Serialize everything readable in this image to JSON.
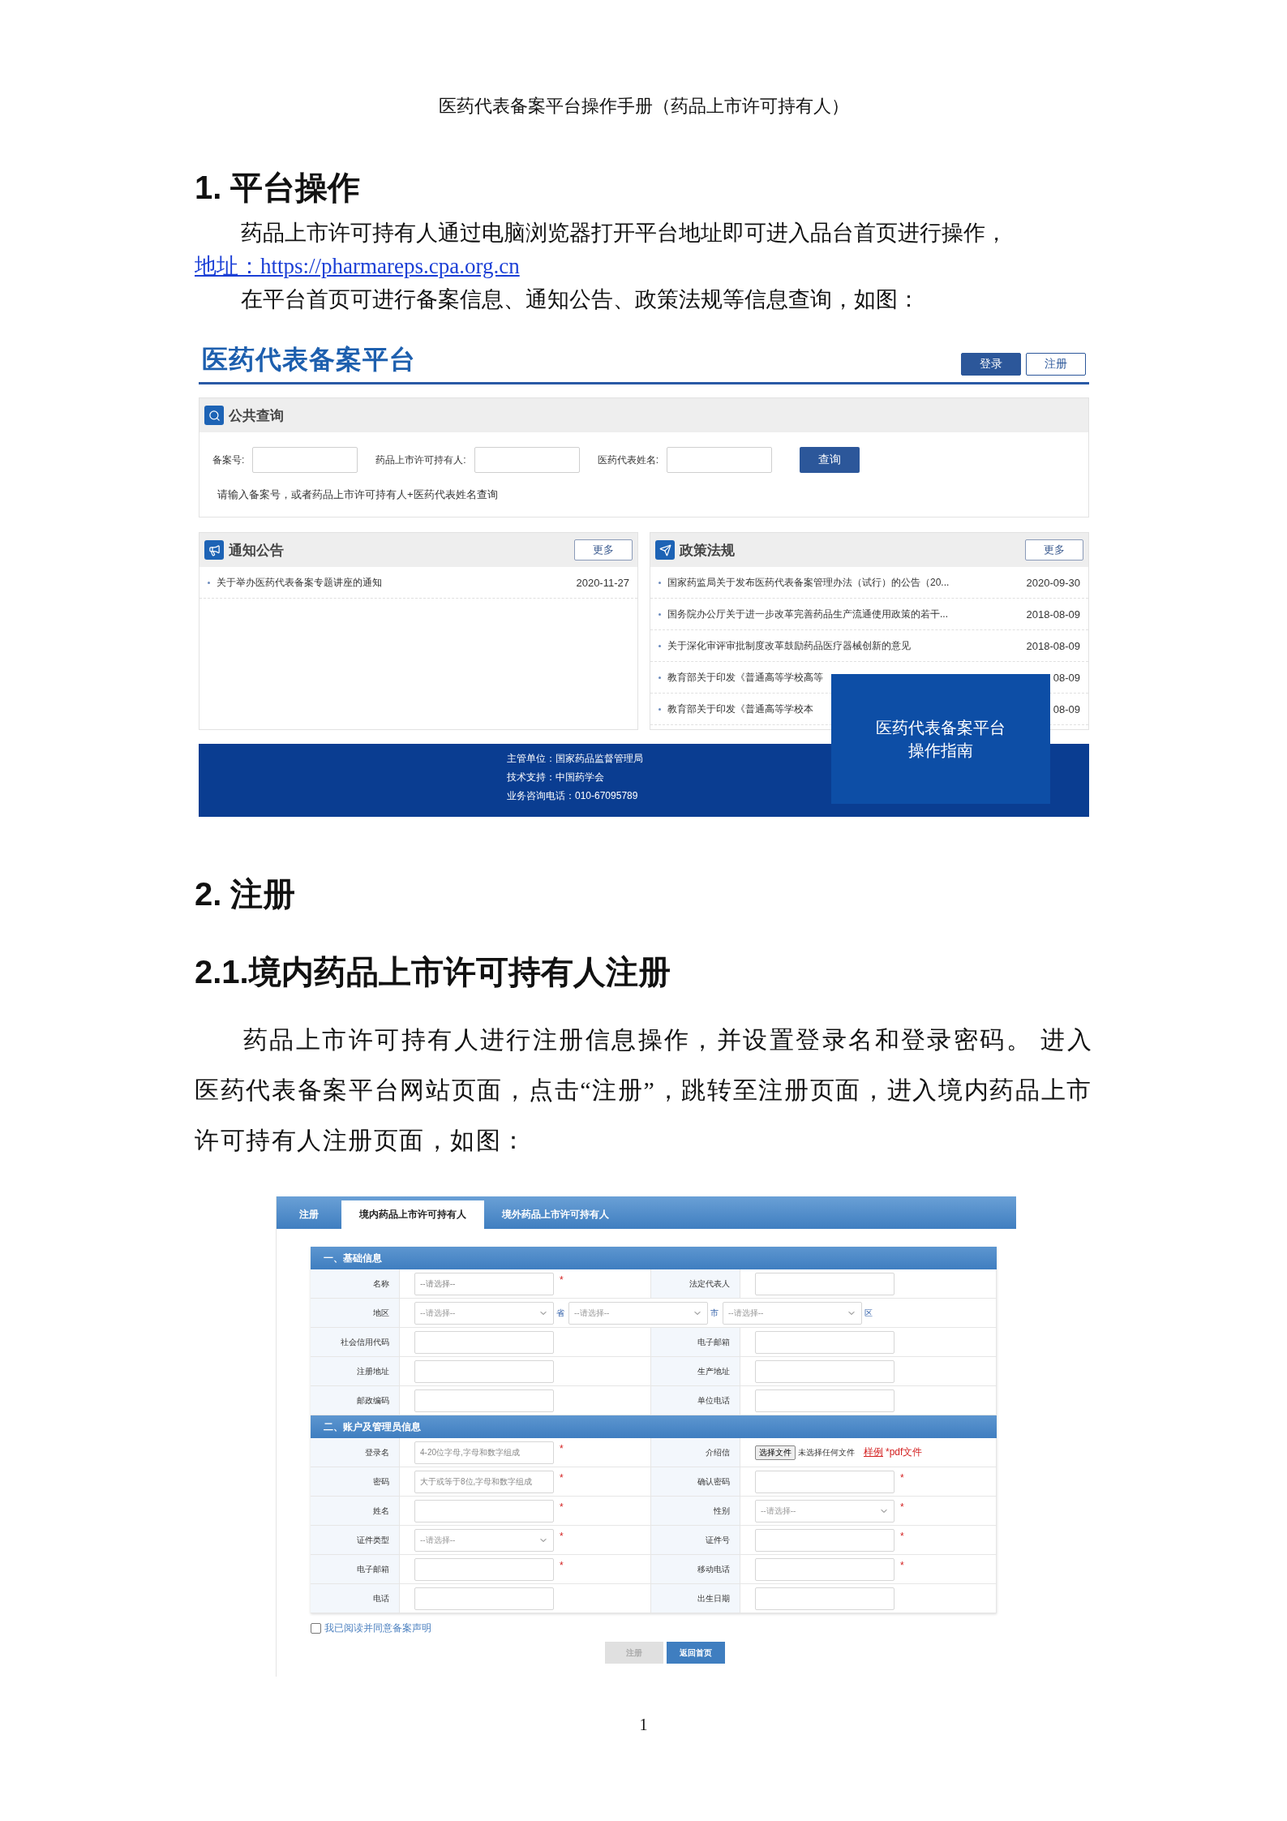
{
  "doc_header": "医药代表备案平台操作手册（药品上市许可持有人）",
  "heading_1": "1. 平台操作",
  "paragraph_1": "药品上市许可持有人通过电脑浏览器打开平台地址即可进入品台首页进行操作，",
  "address_link": "地址：https://pharmareps.cpa.org.cn",
  "paragraph_2": "在平台首页可进行备案信息、通知公告、政策法规等信息查询，如图：",
  "homepage": {
    "logo": "医药代表备案平台",
    "buttons": [
      {
        "label": "登录",
        "kind": "primary"
      },
      {
        "label": "注册",
        "kind": "outline"
      }
    ],
    "public_query": {
      "title": "公共查询",
      "fields": [
        {
          "label": "备案号:"
        },
        {
          "label": "药品上市许可持有人:"
        },
        {
          "label": "医药代表姓名:"
        }
      ],
      "button": "查询",
      "hint": "请输入备案号，或者药品上市许可持有人+医药代表姓名查询"
    },
    "panels": [
      {
        "kind": "announcement",
        "title": "通知公告",
        "more": "更多",
        "items": [
          {
            "title": "关于举办医药代表备案专题讲座的通知",
            "date": "2020-11-27"
          }
        ]
      },
      {
        "kind": "policy",
        "title": "政策法规",
        "more": "更多",
        "items": [
          {
            "title": "国家药监局关于发布医药代表备案管理办法（试行）的公告（20...",
            "date": "2020-09-30"
          },
          {
            "title": "国务院办公厅关于进一步改革完善药品生产流通使用政策的若干...",
            "date": "2018-08-09"
          },
          {
            "title": "关于深化审评审批制度改革鼓励药品医疗器械创新的意见",
            "date": "2018-08-09"
          },
          {
            "title": "教育部关于印发《普通高等学校高等",
            "date": "08-09"
          },
          {
            "title": "教育部关于印发《普通高等学校本",
            "date": "08-09"
          }
        ]
      }
    ],
    "footer": [
      "主管单位：国家药品监督管理局",
      "技术支持：中国药学会",
      "业务咨询电话：010-67095789"
    ],
    "guide_overlay": [
      "医药代表备案平台",
      "操作指南"
    ]
  },
  "heading_2": "2. 注册",
  "heading_2_1": "2.1.境内药品上市许可持有人注册",
  "paragraph_3": "药品上市许可持有人进行注册信息操作，并设置登录名和登录密码。 进入医药代表备案平台网站页面，点击“注册”，跳转至注册页面，进入境内药品上市许可持有人注册页面，如图：",
  "registration": {
    "title": "注册",
    "tabs": [
      {
        "label": "境内药品上市许可持有人",
        "selected": true
      },
      {
        "label": "境外药品上市许可持有人",
        "selected": false
      }
    ],
    "sections": [
      {
        "title": "一、基础信息",
        "rows": [
          {
            "cells": [
              {
                "label": "名称",
                "controls": [
                  {
                    "kind": "input",
                    "placeholder": "--请选择--",
                    "required_mark": "*"
                  }
                ]
              },
              {
                "label": "法定代表人",
                "controls": [
                  {
                    "kind": "input"
                  }
                ]
              }
            ]
          },
          {
            "cells": [
              {
                "label": "地区",
                "controls": [
                  {
                    "kind": "select",
                    "placeholder": "--请选择--",
                    "suffix": "省"
                  },
                  {
                    "kind": "select",
                    "placeholder": "--请选择--",
                    "suffix": "市"
                  },
                  {
                    "kind": "select",
                    "placeholder": "--请选择--",
                    "suffix": "区"
                  }
                ]
              }
            ]
          },
          {
            "cells": [
              {
                "label": "社会信用代码",
                "controls": [
                  {
                    "kind": "input"
                  }
                ]
              },
              {
                "label": "电子邮箱",
                "controls": [
                  {
                    "kind": "input"
                  }
                ]
              }
            ]
          },
          {
            "cells": [
              {
                "label": "注册地址",
                "controls": [
                  {
                    "kind": "input"
                  }
                ]
              },
              {
                "label": "生产地址",
                "controls": [
                  {
                    "kind": "input"
                  }
                ]
              }
            ]
          },
          {
            "cells": [
              {
                "label": "邮政编码",
                "controls": [
                  {
                    "kind": "input"
                  }
                ]
              },
              {
                "label": "单位电话",
                "controls": [
                  {
                    "kind": "input"
                  }
                ]
              }
            ]
          }
        ]
      },
      {
        "title": "二、账户及管理员信息",
        "rows": [
          {
            "cells": [
              {
                "label": "登录名",
                "controls": [
                  {
                    "kind": "input",
                    "placeholder": "4-20位字母,字母和数字组成",
                    "required_mark": "*"
                  }
                ]
              },
              {
                "label": "介绍信",
                "controls": [
                  {
                    "kind": "file",
                    "button": "选择文件",
                    "status": "未选择任何文件",
                    "link": "样例",
                    "note": "*pdf文件"
                  }
                ]
              }
            ]
          },
          {
            "cells": [
              {
                "label": "密码",
                "controls": [
                  {
                    "kind": "input",
                    "placeholder": "大于或等于8位,字母和数字组成",
                    "required_mark": "*"
                  }
                ]
              },
              {
                "label": "确认密码",
                "controls": [
                  {
                    "kind": "input",
                    "required_mark": "*"
                  }
                ]
              }
            ]
          },
          {
            "cells": [
              {
                "label": "姓名",
                "controls": [
                  {
                    "kind": "input",
                    "required_mark": "*"
                  }
                ]
              },
              {
                "label": "性别",
                "controls": [
                  {
                    "kind": "select",
                    "placeholder": "--请选择--",
                    "required_mark": "*"
                  }
                ]
              }
            ]
          },
          {
            "cells": [
              {
                "label": "证件类型",
                "controls": [
                  {
                    "kind": "select",
                    "placeholder": "--请选择--",
                    "required_mark": "*"
                  }
                ]
              },
              {
                "label": "证件号",
                "controls": [
                  {
                    "kind": "input",
                    "required_mark": "*"
                  }
                ]
              }
            ]
          },
          {
            "cells": [
              {
                "label": "电子邮箱",
                "controls": [
                  {
                    "kind": "input",
                    "required_mark": "*"
                  }
                ]
              },
              {
                "label": "移动电话",
                "controls": [
                  {
                    "kind": "input",
                    "required_mark": "*"
                  }
                ]
              }
            ]
          },
          {
            "cells": [
              {
                "label": "电话",
                "controls": [
                  {
                    "kind": "input"
                  }
                ]
              },
              {
                "label": "出生日期",
                "controls": [
                  {
                    "kind": "input"
                  }
                ]
              }
            ]
          }
        ]
      }
    ],
    "agreement": {
      "label": "我已阅读并同意备案声明",
      "checked": false
    },
    "buttons": [
      {
        "label": "注册",
        "disabled": true
      },
      {
        "label": "返回首页",
        "disabled": false
      }
    ]
  },
  "page_number": "1"
}
